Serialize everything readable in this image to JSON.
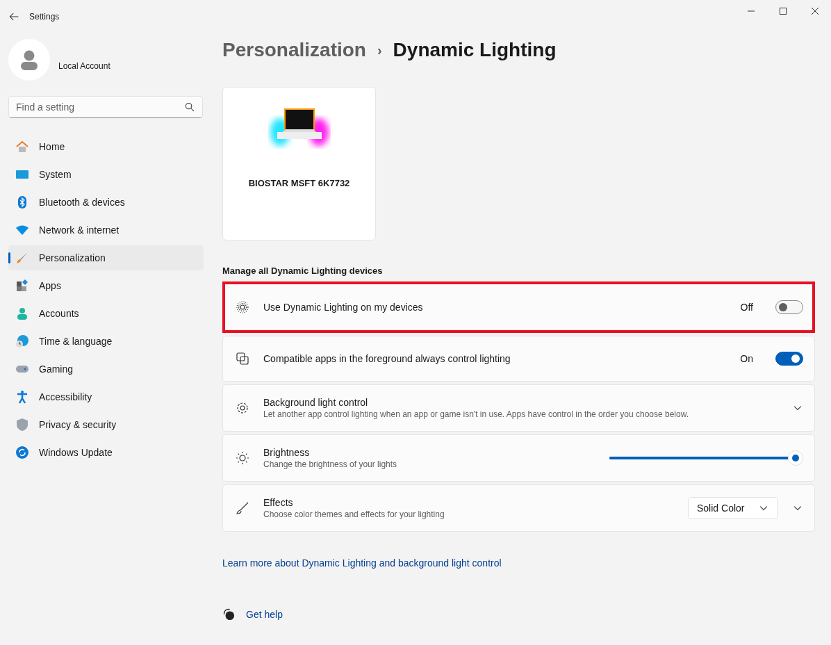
{
  "window": {
    "title": "Settings"
  },
  "account": {
    "name": "Local Account"
  },
  "search": {
    "placeholder": "Find a setting"
  },
  "sidebar": {
    "items": [
      {
        "label": "Home",
        "selected": false
      },
      {
        "label": "System",
        "selected": false
      },
      {
        "label": "Bluetooth & devices",
        "selected": false
      },
      {
        "label": "Network & internet",
        "selected": false
      },
      {
        "label": "Personalization",
        "selected": true
      },
      {
        "label": "Apps",
        "selected": false
      },
      {
        "label": "Accounts",
        "selected": false
      },
      {
        "label": "Time & language",
        "selected": false
      },
      {
        "label": "Gaming",
        "selected": false
      },
      {
        "label": "Accessibility",
        "selected": false
      },
      {
        "label": "Privacy & security",
        "selected": false
      },
      {
        "label": "Windows Update",
        "selected": false
      }
    ]
  },
  "breadcrumb": {
    "parent": "Personalization",
    "separator": "›",
    "current": "Dynamic Lighting"
  },
  "device": {
    "name": "BIOSTAR MSFT 6K7732"
  },
  "section_title": "Manage all Dynamic Lighting devices",
  "settings": [
    {
      "kind": "toggle",
      "title": "Use Dynamic Lighting on my devices",
      "state_label": "Off",
      "on": false,
      "highlighted": true
    },
    {
      "kind": "toggle",
      "title": "Compatible apps in the foreground always control lighting",
      "state_label": "On",
      "on": true,
      "highlighted": false
    },
    {
      "kind": "expander",
      "title": "Background light control",
      "description": "Let another app control lighting when an app or game isn't in use. Apps have control in the order you choose below.",
      "highlighted": false
    },
    {
      "kind": "slider",
      "title": "Brightness",
      "description": "Change the brightness of your lights",
      "level": 1,
      "highlighted": false
    },
    {
      "kind": "dropdown",
      "title": "Effects",
      "description": "Choose color themes and effects for your lighting",
      "value": "Solid Color",
      "highlighted": false
    }
  ],
  "links": [
    {
      "label": "Learn more about Dynamic Lighting and background light control"
    }
  ],
  "help": {
    "label": "Get help"
  }
}
